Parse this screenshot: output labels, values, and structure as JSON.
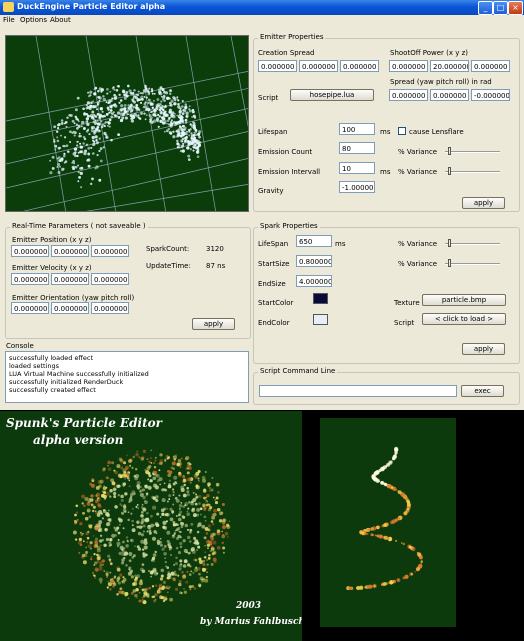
{
  "window": {
    "title": "DuckEngine Particle Editor alpha",
    "menu": [
      "File",
      "Options",
      "About"
    ]
  },
  "emitter_properties": {
    "group_label": "Emitter Properties",
    "creation_spread_label": "Creation Spread",
    "creation_spread": [
      "0.000000",
      "0.000000",
      "0.000000"
    ],
    "shootoff_label": "ShootOff Power (x y z)",
    "shootoff": [
      "0.000000",
      "20.000000",
      "0.000000"
    ],
    "spread_label": "Spread (yaw pitch roll) in rad",
    "spread": [
      "0.000000",
      "0.000000",
      "-0.000000"
    ],
    "script_label": "Script",
    "script_button": "hosepipe.lua",
    "lifespan_label": "Lifespan",
    "lifespan": "100",
    "lifespan_unit": "ms",
    "lensflare_label": "cause Lensflare",
    "emission_count_label": "Emission Count",
    "emission_count": "80",
    "variance_label": "% Variance",
    "emission_interval_label": "Emission Intervall",
    "emission_interval": "10",
    "emission_interval_unit": "ms",
    "gravity_label": "Gravity",
    "gravity": "-1.000000",
    "apply_label": "apply",
    "count_variance": 0.05,
    "interval_variance": 0.05
  },
  "realtime": {
    "group_label": "Real-Time Parameters ( not saveable )",
    "position_label": "Emitter Position (x y z)",
    "position": [
      "0.000000",
      "0.000000",
      "0.000000"
    ],
    "velocity_label": "Emitter Velocity (x y z)",
    "velocity": [
      "0.000000",
      "0.000000",
      "0.000000"
    ],
    "orientation_label": "Emitter Orientation (yaw pitch roll)",
    "orientation": [
      "0.000000",
      "0.000000",
      "0.000000"
    ],
    "spark_count_label": "SparkCount:",
    "spark_count": "3120",
    "update_time_label": "UpdateTime:",
    "update_time": "87 ns",
    "apply_label": "apply"
  },
  "spark_properties": {
    "group_label": "Spark Properties",
    "lifespan_label": "LifeSpan",
    "lifespan": "650",
    "lifespan_unit": "ms",
    "variance_label": "% Variance",
    "startsize_label": "StartSize",
    "startsize": "0.800000",
    "endsize_label": "EndSize",
    "endsize": "4.000000",
    "startcolor_label": "StartColor",
    "startcolor": "#0a0a3a",
    "endcolor_label": "EndColor",
    "endcolor": "#e8eef6",
    "texture_label": "Texture",
    "texture_button": "particle.bmp",
    "script_label": "Script",
    "script_button": "< click to load >",
    "apply_label": "apply",
    "lifespan_variance": 0.05,
    "size_variance": 0.05
  },
  "console": {
    "label": "Console",
    "lines": [
      "successfully loaded effect",
      "loaded settings",
      "LUA Virtual Machine successfully initialized",
      "successfully initialized RenderDuck",
      "successfully created effect"
    ]
  },
  "script_command": {
    "group_label": "Script Command Line",
    "input_value": "",
    "exec_label": "exec"
  },
  "credits": {
    "title": "Spunk's Particle Editor",
    "subtitle": "alpha version",
    "year": "2003",
    "author": "by Marius Fahlbusch"
  }
}
